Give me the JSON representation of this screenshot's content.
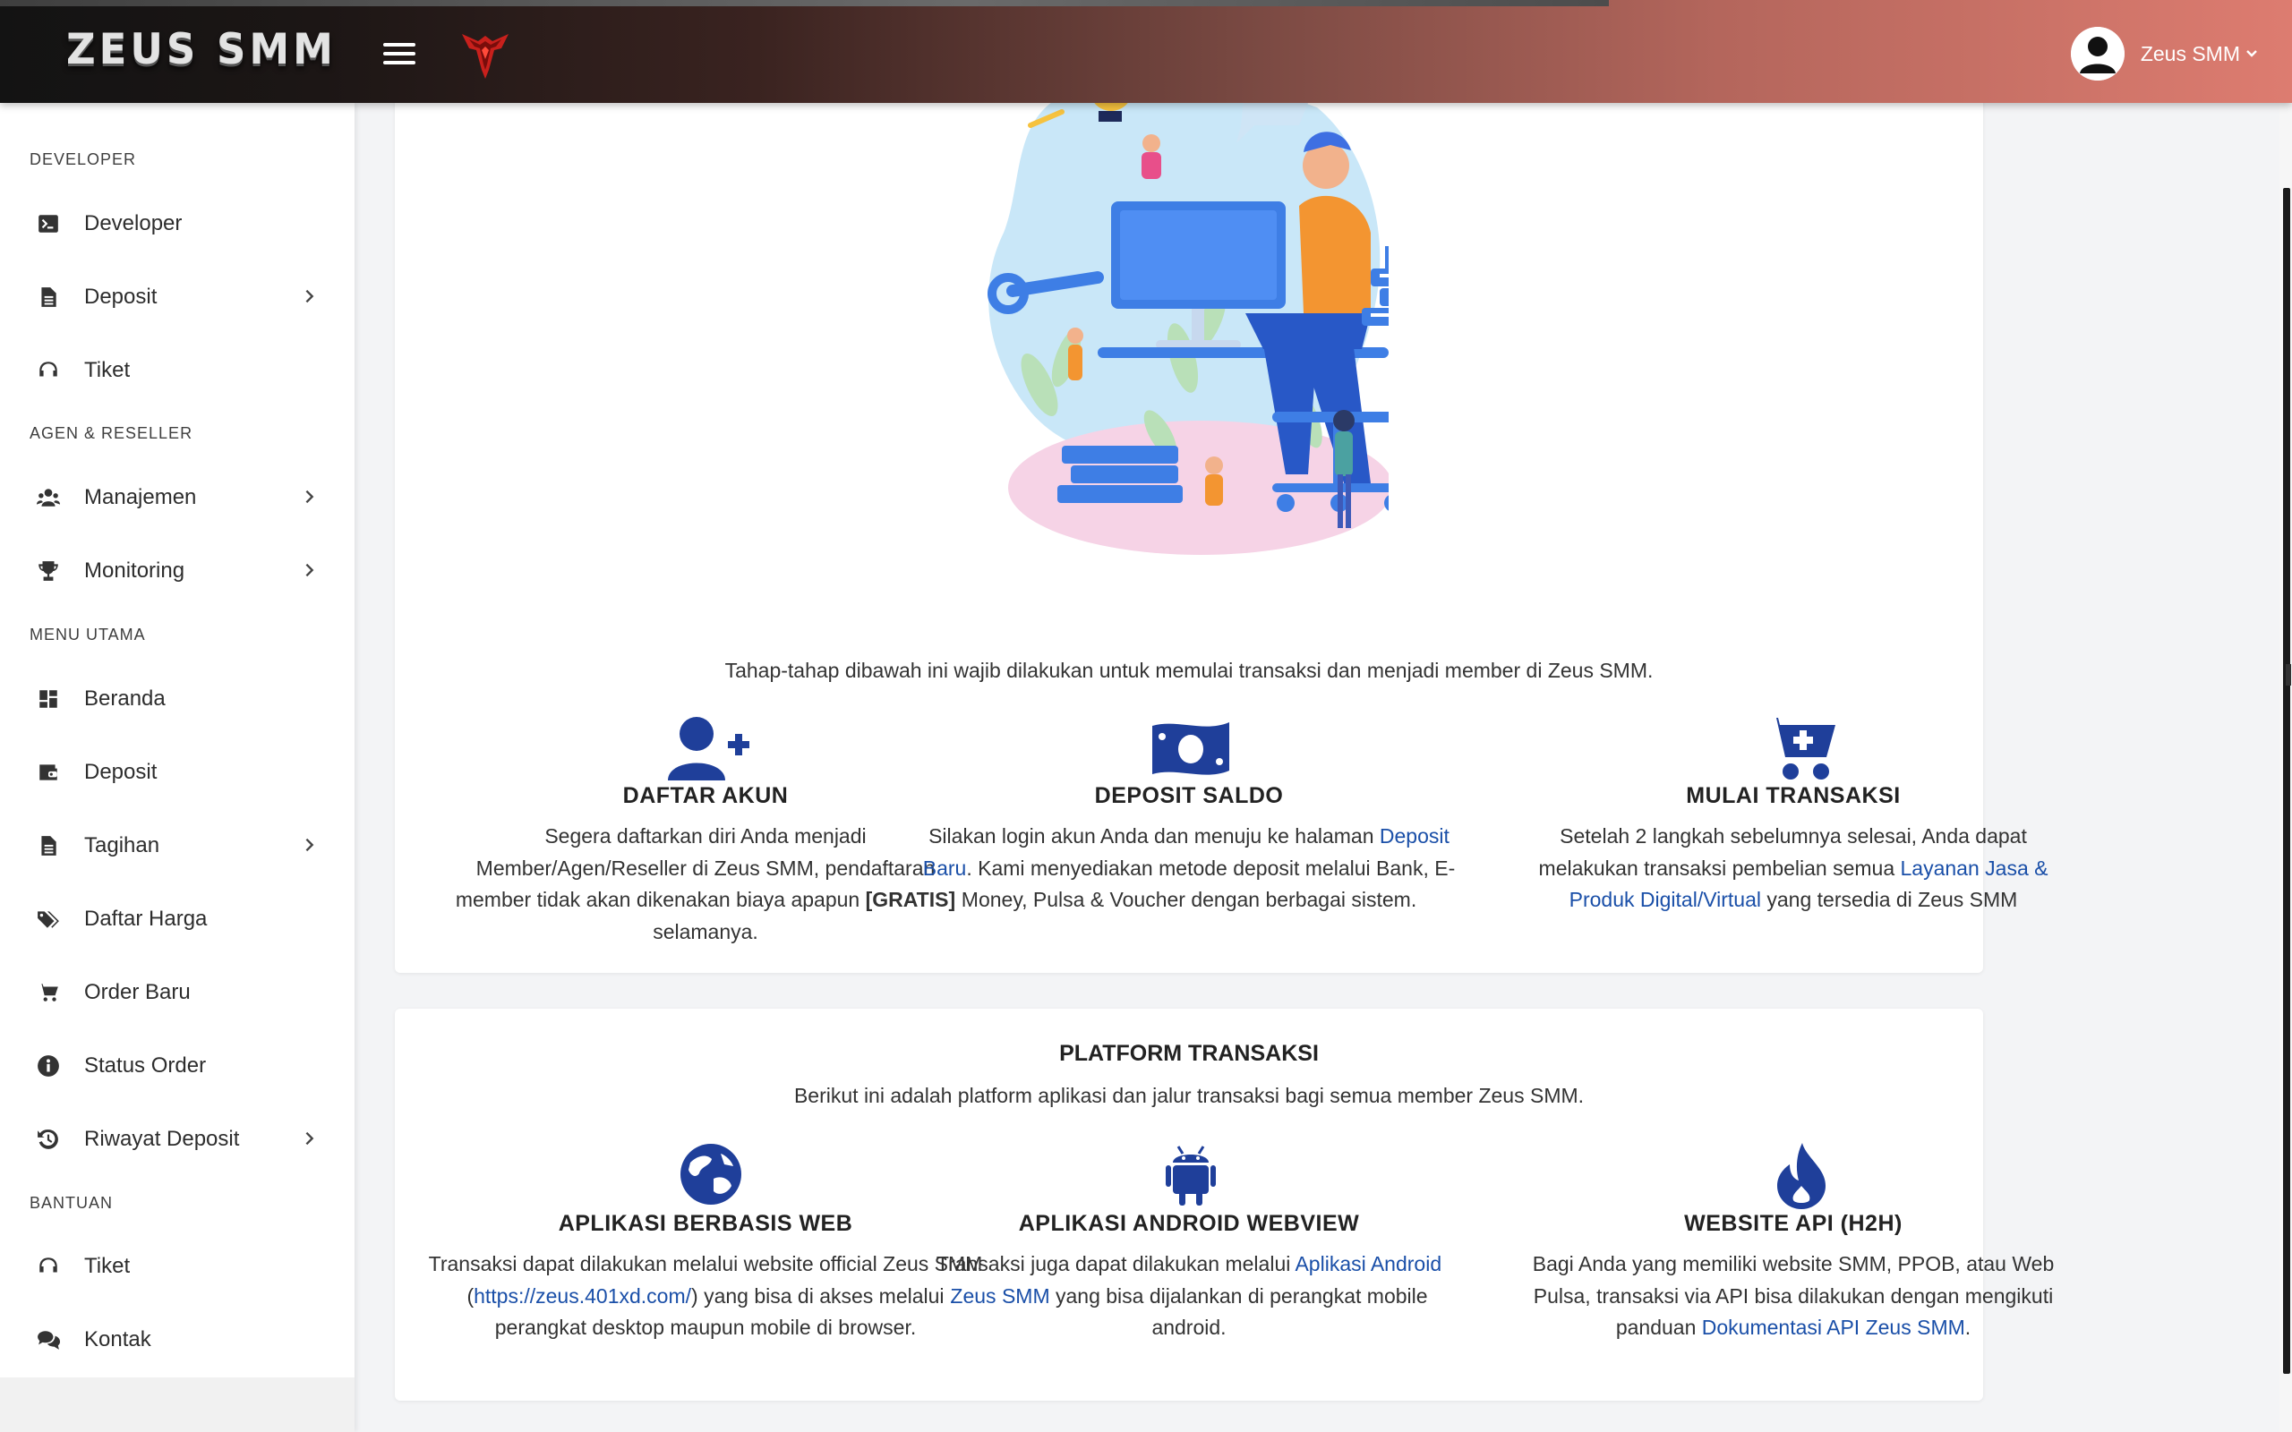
{
  "header": {
    "brand": "ZEUS SMM",
    "user_name": "Zeus SMM",
    "caret": "⌄"
  },
  "colors": {
    "primary_blue": "#1f3f9a",
    "link_blue": "#1a4fa8",
    "header_gradient_start": "#131313",
    "header_gradient_end": "#dd7c70"
  },
  "sidebar": {
    "sections": [
      {
        "title": "DEVELOPER",
        "items": [
          {
            "label": "Developer",
            "icon": "terminal-icon",
            "has_children": false
          },
          {
            "label": "Deposit",
            "icon": "file-icon",
            "has_children": true
          },
          {
            "label": "Tiket",
            "icon": "headset-icon",
            "has_children": false
          }
        ]
      },
      {
        "title": "AGEN & RESELLER",
        "items": [
          {
            "label": "Manajemen",
            "icon": "users-icon",
            "has_children": true
          },
          {
            "label": "Monitoring",
            "icon": "trophy-icon",
            "has_children": true
          }
        ]
      },
      {
        "title": "MENU UTAMA",
        "items": [
          {
            "label": "Beranda",
            "icon": "dashboard-icon",
            "has_children": false
          },
          {
            "label": "Deposit",
            "icon": "wallet-icon",
            "has_children": false
          },
          {
            "label": "Tagihan",
            "icon": "file-icon",
            "has_children": true
          },
          {
            "label": "Daftar Harga",
            "icon": "tags-icon",
            "has_children": false
          },
          {
            "label": "Order Baru",
            "icon": "cart-icon",
            "has_children": false
          },
          {
            "label": "Status Order",
            "icon": "info-icon",
            "has_children": false
          },
          {
            "label": "Riwayat Deposit",
            "icon": "history-icon",
            "has_children": true
          }
        ]
      },
      {
        "title": "BANTUAN",
        "items": [
          {
            "label": "Tiket",
            "icon": "headset-icon",
            "has_children": false
          },
          {
            "label": "Kontak",
            "icon": "comments-icon",
            "has_children": false
          }
        ]
      }
    ]
  },
  "steps": {
    "intro": "Tahap-tahap dibawah ini wajib dilakukan untuk memulai transaksi dan menjadi member di Zeus SMM.",
    "items": [
      {
        "icon": "user-plus-icon",
        "title": "DAFTAR AKUN",
        "text_a": "Segera daftarkan diri Anda menjadi Member/Agen/Reseller di Zeus SMM, pendaftaran member tidak akan dikenakan biaya apapun ",
        "text_bold": "[GRATIS]",
        "text_b": " selamanya."
      },
      {
        "icon": "money-bill-icon",
        "title": "DEPOSIT SALDO",
        "text_a": "Silakan login akun Anda dan menuju ke halaman ",
        "link": "Deposit Baru",
        "text_b": ". Kami menyediakan metode deposit melalui Bank, E-Money, Pulsa & Voucher dengan berbagai sistem."
      },
      {
        "icon": "cart-plus-icon",
        "title": "MULAI TRANSAKSI",
        "text_a": "Setelah 2 langkah sebelumnya selesai, Anda dapat melakukan transaksi pembelian semua ",
        "link": "Layanan Jasa & Produk Digital/Virtual",
        "text_b": " yang tersedia di Zeus SMM"
      }
    ]
  },
  "platform": {
    "title": "PLATFORM TRANSAKSI",
    "subtitle": "Berikut ini adalah platform aplikasi dan jalur transaksi bagi semua member Zeus SMM.",
    "items": [
      {
        "icon": "globe-icon",
        "title": "APLIKASI BERBASIS WEB",
        "text_a": "Transaksi dapat dilakukan melalui website official Zeus SMM (",
        "link": "https://zeus.401xd.com/",
        "text_b": ") yang bisa di akses melalui perangkat desktop maupun mobile di browser."
      },
      {
        "icon": "android-icon",
        "title": "APLIKASI ANDROID WEBVIEW",
        "text_a": "Transaksi juga dapat dilakukan melalui ",
        "link": "Aplikasi Android Zeus SMM",
        "text_b": " yang bisa dijalankan di perangkat mobile android."
      },
      {
        "icon": "fire-icon",
        "title": "WEBSITE API (H2H)",
        "text_a": "Bagi Anda yang memiliki website SMM, PPOB, atau Web Pulsa, transaksi via API bisa dilakukan dengan mengikuti panduan ",
        "link": "Dokumentasi API Zeus SMM",
        "text_b": "."
      }
    ]
  }
}
